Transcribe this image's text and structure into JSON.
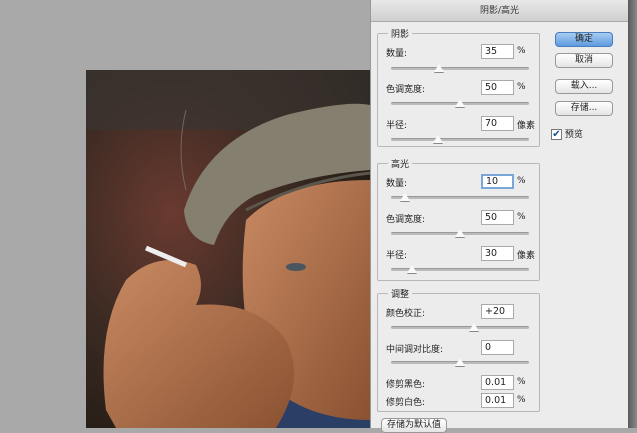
{
  "dialog": {
    "title": "阴影/高光"
  },
  "shadows": {
    "title": "阴影",
    "amount": {
      "label": "数量:",
      "value": "35",
      "unit": "%",
      "slider": 0.35
    },
    "tonal_width": {
      "label": "色调宽度:",
      "value": "50",
      "unit": "%",
      "slider": 0.5
    },
    "radius": {
      "label": "半径:",
      "value": "70",
      "unit": "像素",
      "slider": 0.34
    }
  },
  "highlights": {
    "title": "高光",
    "amount": {
      "label": "数量:",
      "value": "10",
      "unit": "%",
      "slider": 0.1
    },
    "tonal_width": {
      "label": "色调宽度:",
      "value": "50",
      "unit": "%",
      "slider": 0.5
    },
    "radius": {
      "label": "半径:",
      "value": "30",
      "unit": "像素",
      "slider": 0.15
    }
  },
  "adjustments": {
    "title": "调整",
    "color_correction": {
      "label": "颜色校正:",
      "value": "+20",
      "slider": 0.6
    },
    "midtone_contrast": {
      "label": "中间调对比度:",
      "value": "0",
      "slider": 0.5
    },
    "black_clip": {
      "label": "修剪黑色:",
      "value": "0.01",
      "unit": "%"
    },
    "white_clip": {
      "label": "修剪白色:",
      "value": "0.01",
      "unit": "%"
    }
  },
  "buttons": {
    "ok": "确定",
    "cancel": "取消",
    "load": "载入...",
    "save": "存储...",
    "save_default": "存储为默认值"
  },
  "preview": {
    "label": "预览",
    "checked": true
  }
}
